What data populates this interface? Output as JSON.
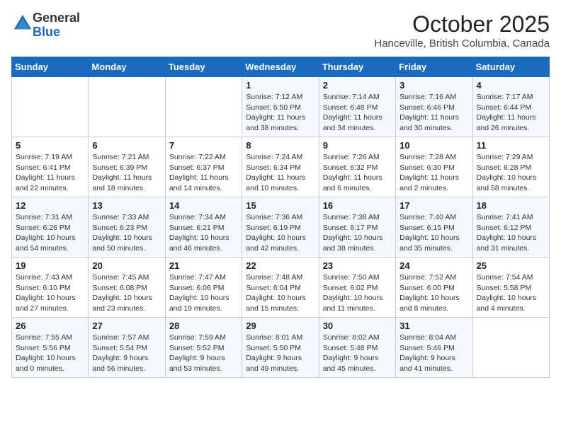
{
  "logo": {
    "general": "General",
    "blue": "Blue"
  },
  "title": "October 2025",
  "location": "Hanceville, British Columbia, Canada",
  "days_of_week": [
    "Sunday",
    "Monday",
    "Tuesday",
    "Wednesday",
    "Thursday",
    "Friday",
    "Saturday"
  ],
  "weeks": [
    [
      {
        "day": "",
        "info": ""
      },
      {
        "day": "",
        "info": ""
      },
      {
        "day": "",
        "info": ""
      },
      {
        "day": "1",
        "info": "Sunrise: 7:12 AM\nSunset: 6:50 PM\nDaylight: 11 hours\nand 38 minutes."
      },
      {
        "day": "2",
        "info": "Sunrise: 7:14 AM\nSunset: 6:48 PM\nDaylight: 11 hours\nand 34 minutes."
      },
      {
        "day": "3",
        "info": "Sunrise: 7:16 AM\nSunset: 6:46 PM\nDaylight: 11 hours\nand 30 minutes."
      },
      {
        "day": "4",
        "info": "Sunrise: 7:17 AM\nSunset: 6:44 PM\nDaylight: 11 hours\nand 26 minutes."
      }
    ],
    [
      {
        "day": "5",
        "info": "Sunrise: 7:19 AM\nSunset: 6:41 PM\nDaylight: 11 hours\nand 22 minutes."
      },
      {
        "day": "6",
        "info": "Sunrise: 7:21 AM\nSunset: 6:39 PM\nDaylight: 11 hours\nand 18 minutes."
      },
      {
        "day": "7",
        "info": "Sunrise: 7:22 AM\nSunset: 6:37 PM\nDaylight: 11 hours\nand 14 minutes."
      },
      {
        "day": "8",
        "info": "Sunrise: 7:24 AM\nSunset: 6:34 PM\nDaylight: 11 hours\nand 10 minutes."
      },
      {
        "day": "9",
        "info": "Sunrise: 7:26 AM\nSunset: 6:32 PM\nDaylight: 11 hours\nand 6 minutes."
      },
      {
        "day": "10",
        "info": "Sunrise: 7:28 AM\nSunset: 6:30 PM\nDaylight: 11 hours\nand 2 minutes."
      },
      {
        "day": "11",
        "info": "Sunrise: 7:29 AM\nSunset: 6:28 PM\nDaylight: 10 hours\nand 58 minutes."
      }
    ],
    [
      {
        "day": "12",
        "info": "Sunrise: 7:31 AM\nSunset: 6:26 PM\nDaylight: 10 hours\nand 54 minutes."
      },
      {
        "day": "13",
        "info": "Sunrise: 7:33 AM\nSunset: 6:23 PM\nDaylight: 10 hours\nand 50 minutes."
      },
      {
        "day": "14",
        "info": "Sunrise: 7:34 AM\nSunset: 6:21 PM\nDaylight: 10 hours\nand 46 minutes."
      },
      {
        "day": "15",
        "info": "Sunrise: 7:36 AM\nSunset: 6:19 PM\nDaylight: 10 hours\nand 42 minutes."
      },
      {
        "day": "16",
        "info": "Sunrise: 7:38 AM\nSunset: 6:17 PM\nDaylight: 10 hours\nand 38 minutes."
      },
      {
        "day": "17",
        "info": "Sunrise: 7:40 AM\nSunset: 6:15 PM\nDaylight: 10 hours\nand 35 minutes."
      },
      {
        "day": "18",
        "info": "Sunrise: 7:41 AM\nSunset: 6:12 PM\nDaylight: 10 hours\nand 31 minutes."
      }
    ],
    [
      {
        "day": "19",
        "info": "Sunrise: 7:43 AM\nSunset: 6:10 PM\nDaylight: 10 hours\nand 27 minutes."
      },
      {
        "day": "20",
        "info": "Sunrise: 7:45 AM\nSunset: 6:08 PM\nDaylight: 10 hours\nand 23 minutes."
      },
      {
        "day": "21",
        "info": "Sunrise: 7:47 AM\nSunset: 6:06 PM\nDaylight: 10 hours\nand 19 minutes."
      },
      {
        "day": "22",
        "info": "Sunrise: 7:48 AM\nSunset: 6:04 PM\nDaylight: 10 hours\nand 15 minutes."
      },
      {
        "day": "23",
        "info": "Sunrise: 7:50 AM\nSunset: 6:02 PM\nDaylight: 10 hours\nand 11 minutes."
      },
      {
        "day": "24",
        "info": "Sunrise: 7:52 AM\nSunset: 6:00 PM\nDaylight: 10 hours\nand 8 minutes."
      },
      {
        "day": "25",
        "info": "Sunrise: 7:54 AM\nSunset: 5:58 PM\nDaylight: 10 hours\nand 4 minutes."
      }
    ],
    [
      {
        "day": "26",
        "info": "Sunrise: 7:55 AM\nSunset: 5:56 PM\nDaylight: 10 hours\nand 0 minutes."
      },
      {
        "day": "27",
        "info": "Sunrise: 7:57 AM\nSunset: 5:54 PM\nDaylight: 9 hours\nand 56 minutes."
      },
      {
        "day": "28",
        "info": "Sunrise: 7:59 AM\nSunset: 5:52 PM\nDaylight: 9 hours\nand 53 minutes."
      },
      {
        "day": "29",
        "info": "Sunrise: 8:01 AM\nSunset: 5:50 PM\nDaylight: 9 hours\nand 49 minutes."
      },
      {
        "day": "30",
        "info": "Sunrise: 8:02 AM\nSunset: 5:48 PM\nDaylight: 9 hours\nand 45 minutes."
      },
      {
        "day": "31",
        "info": "Sunrise: 8:04 AM\nSunset: 5:46 PM\nDaylight: 9 hours\nand 41 minutes."
      },
      {
        "day": "",
        "info": ""
      }
    ]
  ]
}
